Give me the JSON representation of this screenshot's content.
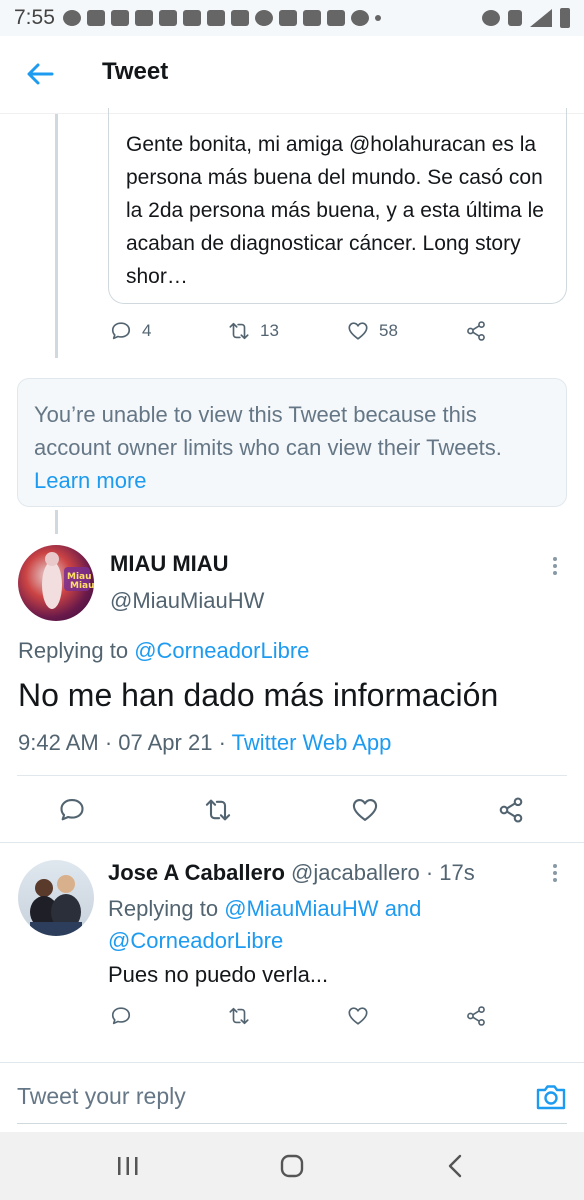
{
  "status_bar": {
    "time": "7:55",
    "icons": [
      "whatsapp-icon",
      "snapchat-icon",
      "twitter-icon",
      "youtube-icon",
      "youtube-icon",
      "youtube-icon",
      "youtube-icon",
      "voicemail-icon",
      "accessibility-icon",
      "mail-icon",
      "gmail-icon",
      "twitter-icon",
      "spotify-icon",
      "dot-icon"
    ],
    "right_icons": [
      "alarm-icon",
      "data-icon",
      "signal-icon",
      "battery-icon"
    ]
  },
  "header": {
    "title": "Tweet"
  },
  "quoted_tweet": {
    "text": "Gente bonita, mi  amiga @holahuracan es la persona más buena del mundo. Se casó con la 2da persona más buena, y a esta última le acaban de diagnosticar cáncer. Long story shor…",
    "replies": "4",
    "retweets": "13",
    "likes": "58"
  },
  "unavailable": {
    "text": "You’re unable to view this Tweet because this account owner limits who can view their Tweets.",
    "link": "Learn more"
  },
  "main_tweet": {
    "name": "MIAU MIAU",
    "handle": "@MiauMiauHW",
    "replying_label": "Replying to",
    "replying_to": "@CorneadorLibre",
    "text": "No me han dado más información",
    "time": "9:42 AM · 07 Apr 21 ·",
    "source": "Twitter Web App"
  },
  "reply_tweet": {
    "name": "Jose A Caballero",
    "handle": "@jacaballero · 17s",
    "replying_label": "Replying to",
    "replying_to_1": "@MiauMiauHW",
    "replying_and": "and",
    "replying_to_2": "@CorneadorLibre",
    "text": "Pues no puedo verla..."
  },
  "reply_bar": {
    "placeholder": "Tweet your reply"
  },
  "colors": {
    "accent": "#1d9bf0",
    "text": "#14171a",
    "secondary": "#536471",
    "border": "#e1e8ed"
  }
}
